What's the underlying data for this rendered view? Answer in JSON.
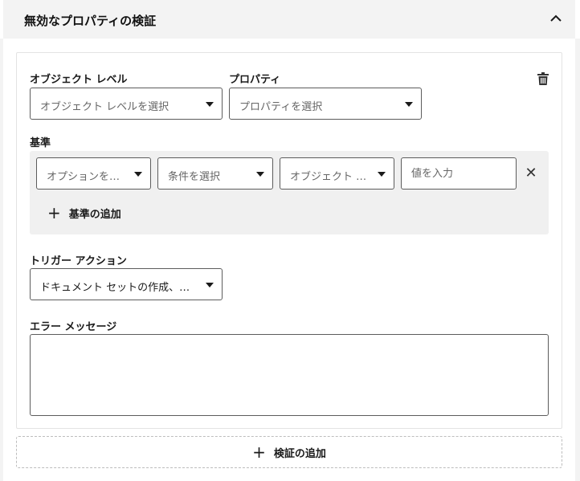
{
  "section": {
    "title": "無効なプロパティの検証"
  },
  "rule": {
    "object_level": {
      "label": "オブジェクト レベル",
      "placeholder": "オブジェクト レベルを選択"
    },
    "property": {
      "label": "プロパティ",
      "placeholder": "プロパティを選択"
    },
    "criteria": {
      "label": "基準",
      "row": {
        "option_placeholder": "オプションを選択",
        "condition_placeholder": "条件を選択",
        "object_level_value": "オブジェクト レ…",
        "value_placeholder": "値を入力",
        "remove_glyph": "✕"
      },
      "add_label": "基準の追加"
    },
    "trigger_action": {
      "label": "トリガー アクション",
      "value": "ドキュメント セットの作成、ドキュメ…"
    },
    "error_message": {
      "label": "エラー メッセージ",
      "value": ""
    }
  },
  "add_validation_label": "検証の追加",
  "icons": {
    "collapse": "chevron-up-icon",
    "delete": "trash-icon",
    "add": "plus-icon",
    "remove": "close-icon",
    "dropdown": "caret-down-icon"
  }
}
